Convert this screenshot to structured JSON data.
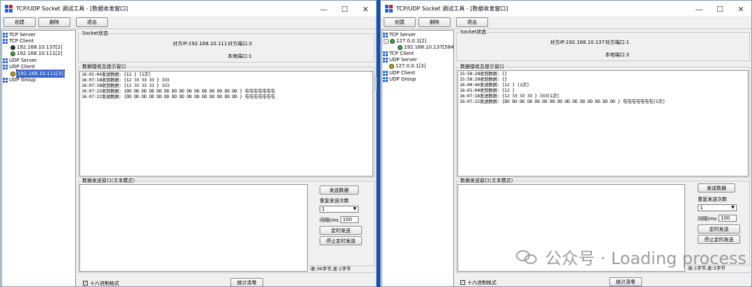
{
  "left": {
    "title": "TCP/UDP Socket 调试工具 - [数据收发窗口]",
    "toolbar": {
      "create": "创建",
      "delete": "删除",
      "exit": "退出"
    },
    "tree": {
      "tcp_server": "TCP Server",
      "tcp_client": "TCP Client",
      "tcp_client_items": [
        "192.168.10.137[2]",
        "192.168.10.111[2]"
      ],
      "udp_server": "UDP Server",
      "udp_client": "UDP Client",
      "udp_client_item": "192.168.10.111[3]",
      "udp_group": "UDP Group"
    },
    "socket_group": "Socket状态",
    "peer_ip": "对方IP:192.168.10.111",
    "peer_port": "对方端口:3",
    "local_port": "本地端口:1",
    "recv_group": "数据接收及提示窗口",
    "log": [
      "16:01:04发送数据: {12 } [1次]",
      "16:07:18收到数据: {12 33 33 33 } 333",
      "16:07:18收到数据: {12 33 33 33 } 333",
      "16:07:22收到数据: {DD DD DD DD DD DD DD DD DD DD DD DD DD DD DD } 屯屯屯屯屯屯屯",
      "16:07:22发送数据: {DD DD DD DD DD DD DD DD DD DD DD DD DD DD DD } 屯屯屯屯屯屯屯"
    ],
    "send_group": "数据发送窗口(文本模式)",
    "send_button": "发送数据",
    "repeat_label": "重复发送次数",
    "repeat_value": "1",
    "interval_label": "间隔(ms",
    "interval_value": "100",
    "timer_send": "定时发送",
    "stop_timer": "停止定时发送",
    "status": "收:36字节,发:1字节",
    "hex_label": "十六进制格式",
    "clear_stats": "统计清零"
  },
  "right": {
    "title": "TCP/UDP Socket 调试工具 - [数据收发窗口]",
    "toolbar": {
      "create": "创建",
      "delete": "删除",
      "exit": "退出"
    },
    "tree": {
      "tcp_server": "TCP Server",
      "tcp_server_item": "127.0.0.1[2]",
      "tcp_server_sub": "192.168.10.137[58497]",
      "tcp_client": "TCP Client",
      "udp_server": "UDP Server",
      "udp_server_item": "127.0.0.1[3]",
      "udp_client": "UDP Client",
      "udp_group": "UDP Group"
    },
    "socket_group": "Socket状态",
    "peer_ip": "对方IP:192.168.10.137",
    "peer_port": "对方端口:1",
    "local_port": "本地端口:3",
    "recv_group": "数据接收及提示窗口",
    "log": [
      "15:58:28收到数据: {}",
      "15:58:29收到数据: {}",
      "16:00:44发送数据: {12 } [1次]",
      "16:01:04收到数据: {12 }",
      "16:07:18发送数据: {12 33 33 33 } 333[1次]",
      "16:07:22发送数据: {DD DD DD DD DD DD DD DD DD DD DD DD DD DD DD } 屯屯屯屯屯屯屯[1次]"
    ],
    "send_group": "数据发送窗口(文本模式)",
    "send_button": "发送数据",
    "repeat_label": "重复发送次数",
    "repeat_value": "1",
    "interval_label": "间隔(ms",
    "interval_value": "100",
    "timer_send": "定时发送",
    "stop_timer": "停止定时发送",
    "status": "收:1字节,发:5字节",
    "hex_label": "十六进制格式",
    "clear_stats": "统计清零"
  },
  "watermark": "公众号 · Loading process"
}
